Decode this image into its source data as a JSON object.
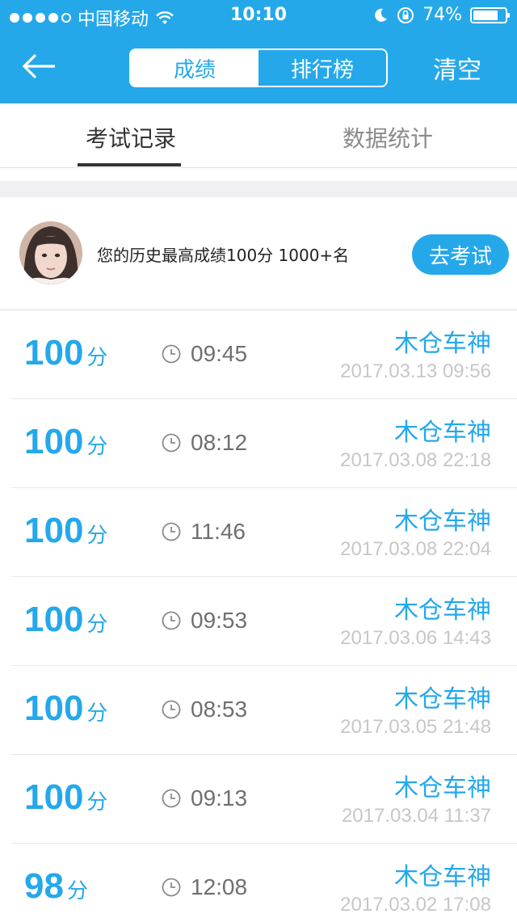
{
  "status_bar": {
    "carrier": "中国移动",
    "time": "10:10",
    "battery": "74%",
    "battery_level": 0.74
  },
  "nav": {
    "segments": [
      "成绩",
      "排行榜"
    ],
    "active_segment": 0,
    "clear_label": "清空"
  },
  "tabs": {
    "items": [
      "考试记录",
      "数据统计"
    ],
    "active": 0
  },
  "summary": {
    "best_text": "您的历史最高成绩100分  1000+名",
    "go_button": "去考试"
  },
  "records": [
    {
      "score": "100",
      "unit": "分",
      "duration": "09:45",
      "name": "木仓车神",
      "date": "2017.03.13 09:56"
    },
    {
      "score": "100",
      "unit": "分",
      "duration": "08:12",
      "name": "木仓车神",
      "date": "2017.03.08 22:18"
    },
    {
      "score": "100",
      "unit": "分",
      "duration": "11:46",
      "name": "木仓车神",
      "date": "2017.03.08 22:04"
    },
    {
      "score": "100",
      "unit": "分",
      "duration": "09:53",
      "name": "木仓车神",
      "date": "2017.03.06 14:43"
    },
    {
      "score": "100",
      "unit": "分",
      "duration": "08:53",
      "name": "木仓车神",
      "date": "2017.03.05 21:48"
    },
    {
      "score": "100",
      "unit": "分",
      "duration": "09:13",
      "name": "木仓车神",
      "date": "2017.03.04 11:37"
    },
    {
      "score": "98",
      "unit": "分",
      "duration": "12:08",
      "name": "木仓车神",
      "date": "2017.03.02 17:08"
    }
  ],
  "colors": {
    "accent": "#25a8ea",
    "muted_text": "#c7c7c7",
    "background_gap": "#efeff4"
  }
}
